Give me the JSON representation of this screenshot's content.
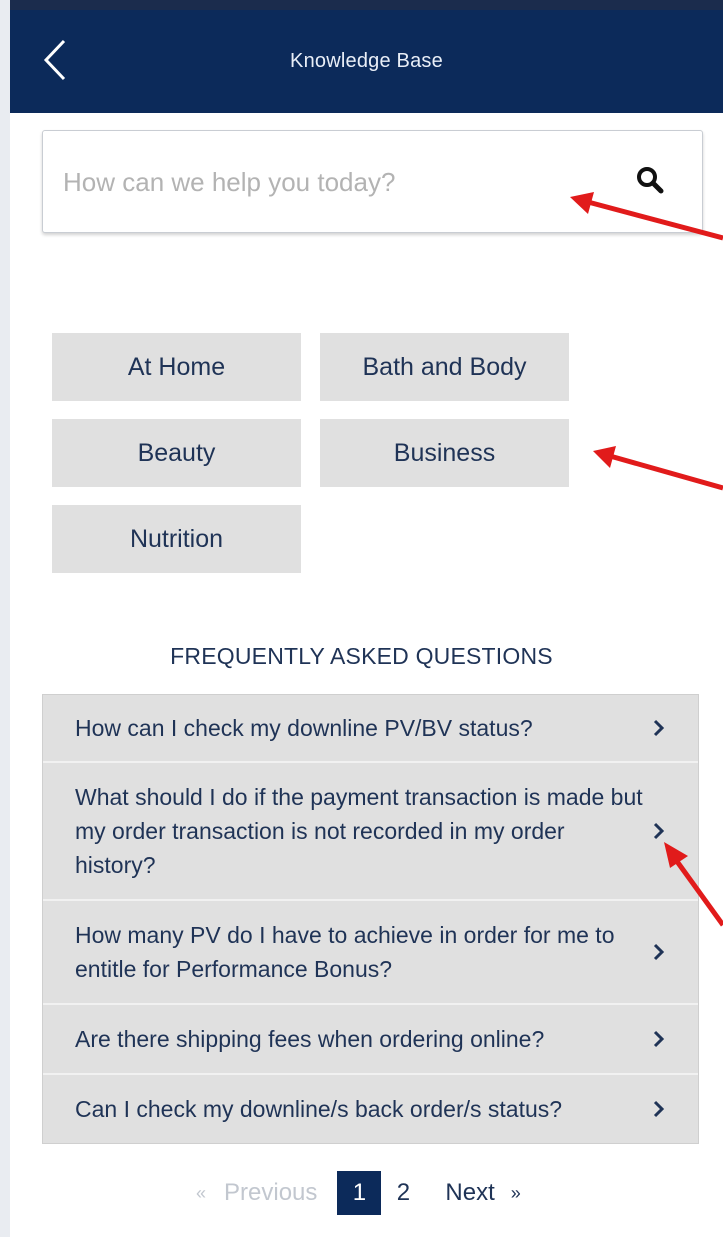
{
  "header": {
    "title": "Knowledge Base",
    "back_icon": "chevron-left-icon"
  },
  "search": {
    "placeholder": "How can we help you today?",
    "value": "",
    "icon": "search-icon"
  },
  "categories": [
    {
      "label": "At Home"
    },
    {
      "label": "Bath and Body"
    },
    {
      "label": "Beauty"
    },
    {
      "label": "Business"
    },
    {
      "label": "Nutrition"
    }
  ],
  "faq": {
    "heading": "FREQUENTLY ASKED QUESTIONS",
    "items": [
      {
        "question": "How can I check my downline PV/BV status?"
      },
      {
        "question": "What should I do if the payment transaction is made but my order transaction is not recorded in my order history?"
      },
      {
        "question": "How many PV do I have to achieve in order for me to entitle for Performance Bonus?"
      },
      {
        "question": "Are there shipping fees when ordering online?"
      },
      {
        "question": "Can I check my downline/s back order/s status?"
      }
    ]
  },
  "pagination": {
    "previous_label": "Previous",
    "previous_chevron": "«",
    "pages": [
      "1",
      "2"
    ],
    "current_page": "1",
    "next_label": "Next",
    "next_chevron": "»"
  },
  "colors": {
    "header_bg": "#0c2a5a",
    "text": "#1f3356",
    "tile_bg": "#e0e0e0",
    "annotation_arrow": "#e11b1b"
  }
}
